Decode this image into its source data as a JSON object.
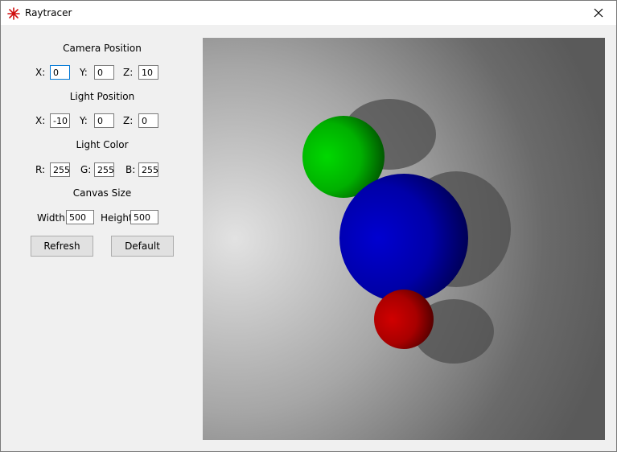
{
  "window": {
    "title": "Raytracer",
    "app_icon": "red-star-icon",
    "close_icon": "close-icon"
  },
  "camera": {
    "title": "Camera Position",
    "x_label": "X:",
    "y_label": "Y:",
    "z_label": "Z:",
    "x": "0",
    "y": "0",
    "z": "10"
  },
  "light": {
    "title": "Light Position",
    "x_label": "X:",
    "y_label": "Y:",
    "z_label": "Z:",
    "x": "-10",
    "y": "0",
    "z": "0"
  },
  "color": {
    "title": "Light Color",
    "r_label": "R:",
    "g_label": "G:",
    "b_label": "B:",
    "r": "255",
    "g": "255",
    "b": "255"
  },
  "canvas": {
    "title": "Canvas Size",
    "width_label": "Width:",
    "height_label": "Height:",
    "width": "500",
    "height": "500"
  },
  "buttons": {
    "refresh": "Refresh",
    "default": "Default"
  },
  "colors": {
    "accent": "#0078d7",
    "background": "#f0f0f0",
    "sphere_green": "#00c000",
    "sphere_blue": "#0000c8",
    "sphere_red": "#c00000"
  }
}
